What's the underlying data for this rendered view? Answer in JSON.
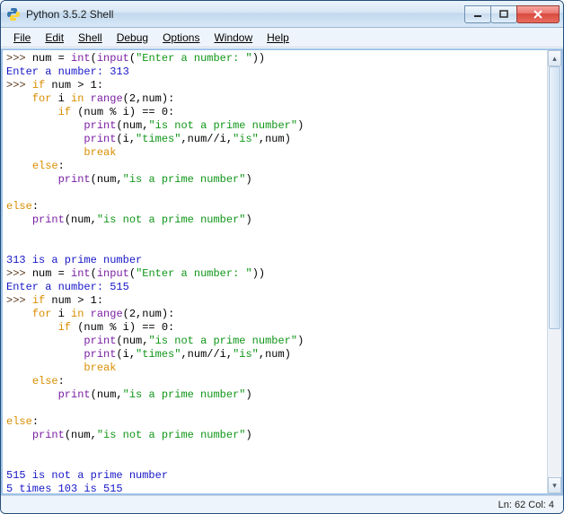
{
  "window": {
    "title": "Python 3.5.2 Shell"
  },
  "menu": {
    "file": "File",
    "edit": "Edit",
    "shell": "Shell",
    "debug": "Debug",
    "options": "Options",
    "window": "Window",
    "help": "Help"
  },
  "code": {
    "prompt": ">>> ",
    "assign1_a": "num = ",
    "assign1_int": "int",
    "assign1_lpar": "(",
    "assign1_input": "input",
    "assign1_paren_open": "(",
    "assign1_str": "\"Enter a number: \"",
    "assign1_close": "))",
    "enter1": "Enter a number: 313",
    "if_kw": "if",
    "if_cond": " num > 1:",
    "for_indent": "    ",
    "for_kw": "for",
    "for_rest_a": " i ",
    "in_kw": "in",
    "for_rest_b": " ",
    "range_fn": "range",
    "for_rest_c": "(2,num):",
    "if2_indent": "        ",
    "if2_cond": " (num % i) == 0:",
    "p_indent": "            ",
    "print_fn": "print",
    "p1_args_a": "(num,",
    "p1_str": "\"is not a prime number\"",
    "p1_args_b": ")",
    "p2_args_a": "(i,",
    "p2_str1": "\"times\"",
    "p2_args_b": ",num//i,",
    "p2_str2": "\"is\"",
    "p2_args_c": ",num)",
    "break_kw": "break",
    "else_indent": "    ",
    "else_kw": "else",
    "else_colon": ":",
    "pe_indent": "        ",
    "pe_args_a": "(num,",
    "pe_str": "\"is a prime number\"",
    "pe_args_b": ")",
    "outer_else_indent": "",
    "po_indent": "    ",
    "po_args_a": "(num,",
    "po_str": "\"is not a prime number\"",
    "po_args_b": ")",
    "out1": "313 is a prime number",
    "enter2": "Enter a number: 515",
    "out2a": "515 is not a prime number",
    "out2b": "5 times 103 is 515"
  },
  "status": {
    "text": "Ln: 62  Col: 4"
  }
}
